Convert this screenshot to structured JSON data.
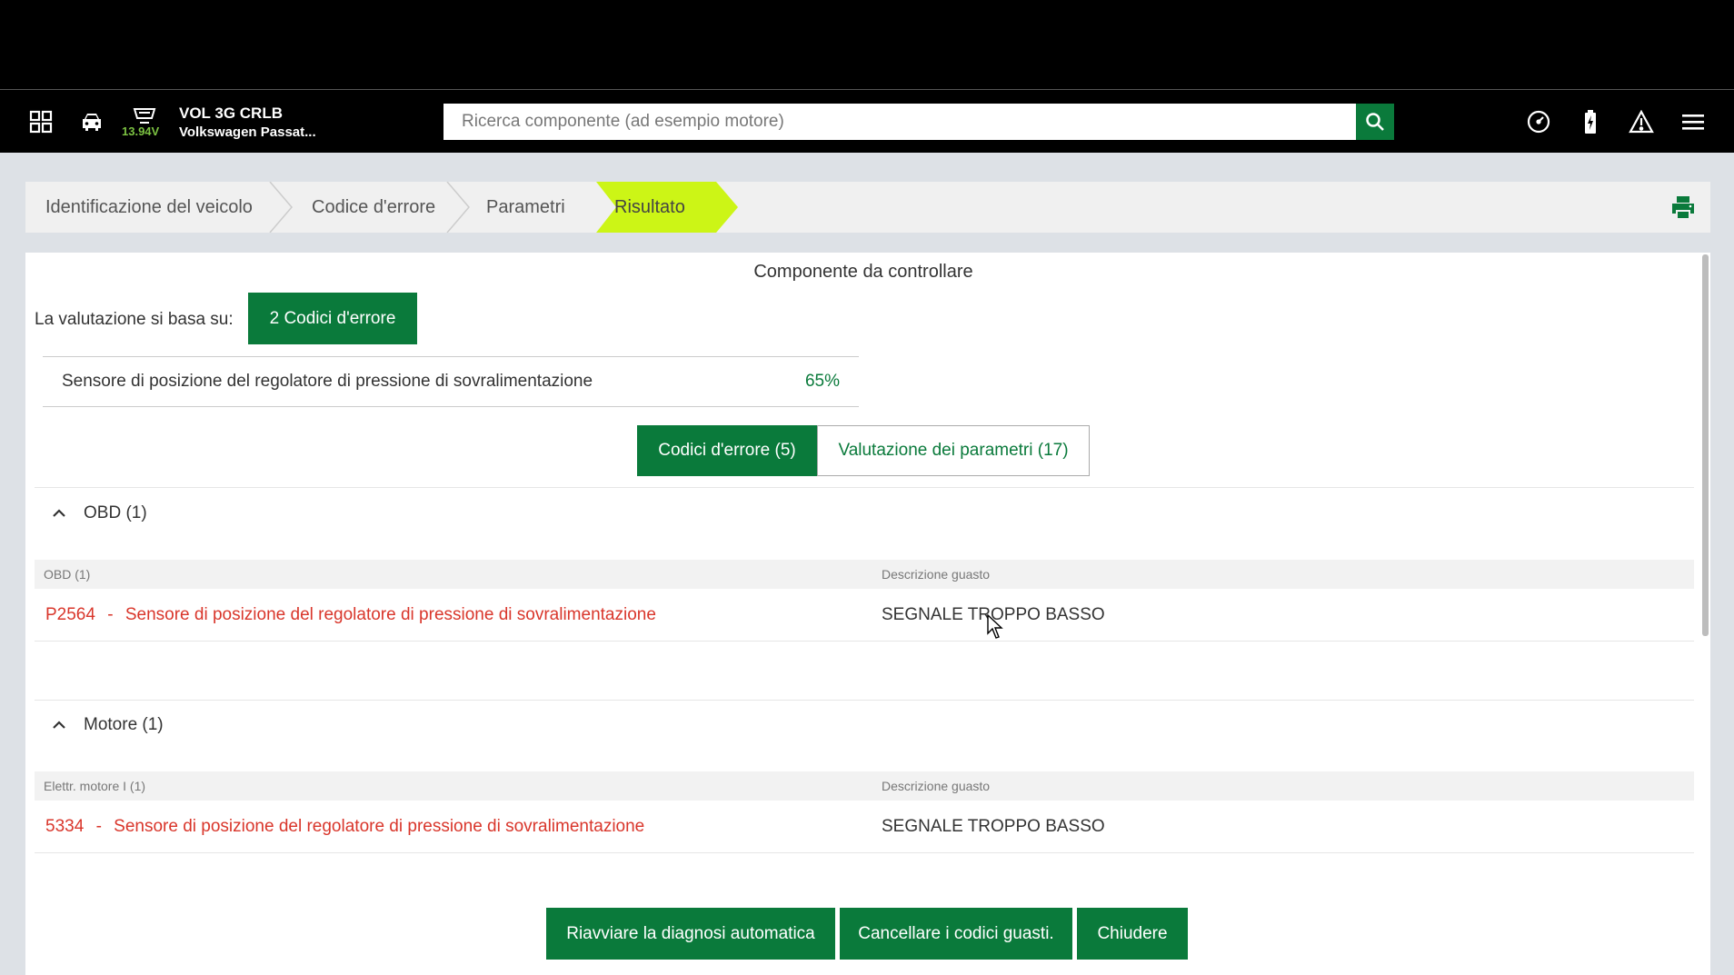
{
  "toolbar": {
    "voltage": "13.94V",
    "vehicle_code": "VOL 3G CRLB",
    "vehicle_name": "Volkswagen Passat...",
    "search_placeholder": "Ricerca componente (ad esempio motore)"
  },
  "breadcrumb": {
    "steps": [
      "Identificazione del veicolo",
      "Codice d'errore",
      "Parametri",
      "Risultato"
    ],
    "active_index": 3,
    "active_color": "#ccf516"
  },
  "main": {
    "title": "Componente da controllare",
    "eval_label": "La valutazione si basa su:",
    "eval_button": "2 Codici d'errore",
    "component": {
      "name": "Sensore di posizione del regolatore di pressione di sovralimentazione",
      "percent": "65%"
    },
    "tabs": {
      "codes": "Codici d'errore (5)",
      "params": "Valutazione dei parametri (17)"
    },
    "groups": [
      {
        "title": "OBD (1)",
        "col1_header": "OBD (1)",
        "col2_header": "Descrizione guasto",
        "code": "P2564",
        "separator": "-",
        "code_desc": "Sensore di posizione del regolatore di pressione di sovralimentazione",
        "fault": "SEGNALE TROPPO BASSO"
      },
      {
        "title": "Motore (1)",
        "col1_header": "Elettr. motore I (1)",
        "col2_header": "Descrizione guasto",
        "code": "5334",
        "separator": "-",
        "code_desc": "Sensore di posizione del regolatore di pressione di sovralimentazione",
        "fault": "SEGNALE TROPPO BASSO"
      }
    ]
  },
  "actions": {
    "restart": "Riavviare la diagnosi automatica",
    "clear": "Cancellare i codici guasti.",
    "close": "Chiudere"
  },
  "colors": {
    "brand_green": "#0a7a3b",
    "error_red": "#d9362b",
    "accent_lime": "#ccf516"
  }
}
